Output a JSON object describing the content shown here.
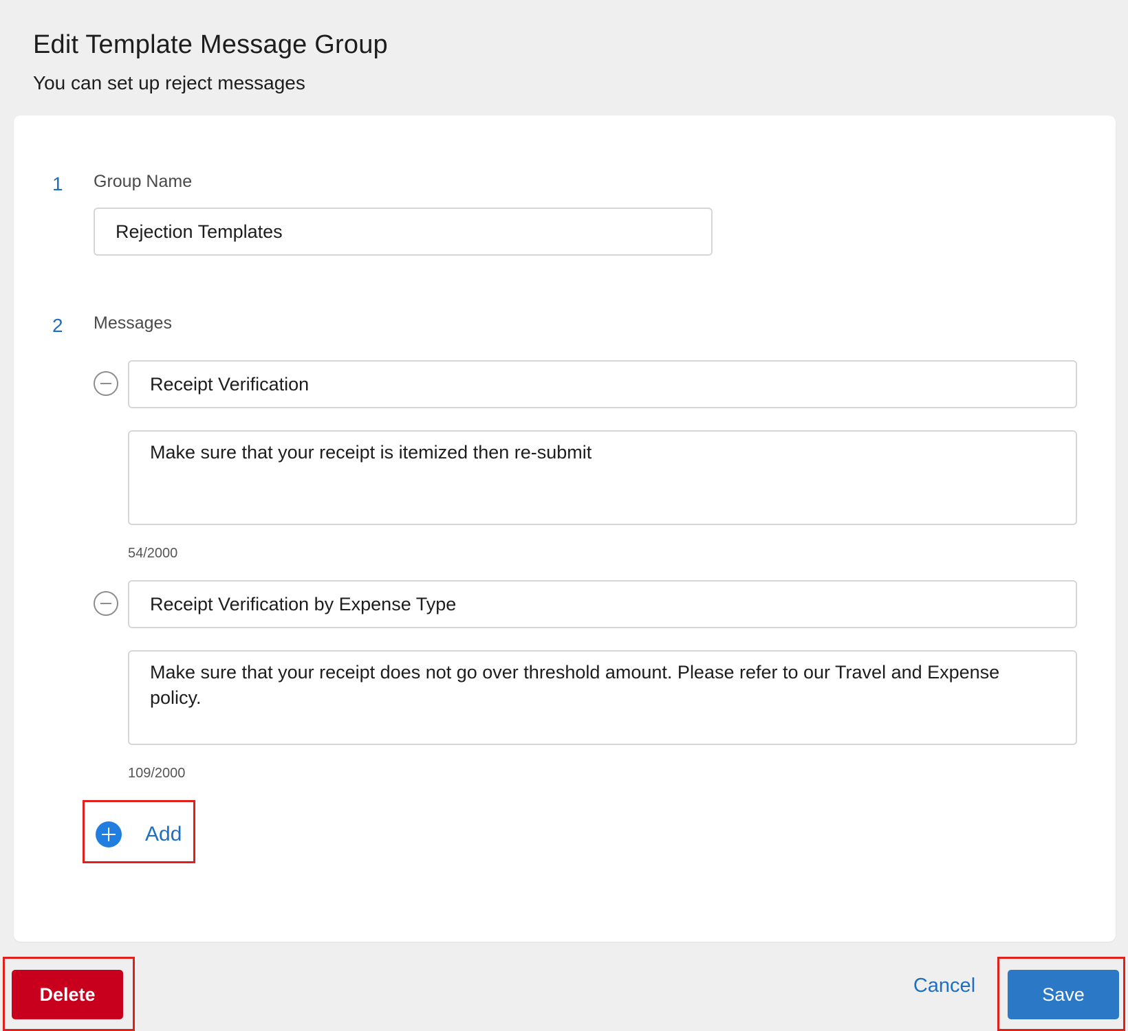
{
  "page": {
    "title": "Edit Template Message Group",
    "subtitle": "You can set up reject messages"
  },
  "sections": {
    "group_name": {
      "number": "1",
      "label": "Group Name",
      "value": "Rejection Templates"
    },
    "messages": {
      "number": "2",
      "label": "Messages",
      "items": [
        {
          "title": "Receipt Verification",
          "body": "Make sure that your receipt is itemized then re-submit",
          "char_count": "54/2000"
        },
        {
          "title": "Receipt Verification by Expense Type",
          "body": "Make sure that your receipt does not go over threshold amount. Please refer to our Travel and Expense policy.",
          "char_count": "109/2000"
        }
      ],
      "add_label": "Add"
    }
  },
  "footer": {
    "delete_label": "Delete",
    "cancel_label": "Cancel",
    "save_label": "Save"
  },
  "colors": {
    "accent_blue": "#1f6fbf",
    "add_icon_blue": "#1f7ee0",
    "save_blue": "#2a78c6",
    "delete_red": "#c8001e",
    "highlight_red": "#e0201b"
  },
  "icons": {
    "remove": "minus-circle-icon",
    "add": "plus-circle-icon"
  }
}
